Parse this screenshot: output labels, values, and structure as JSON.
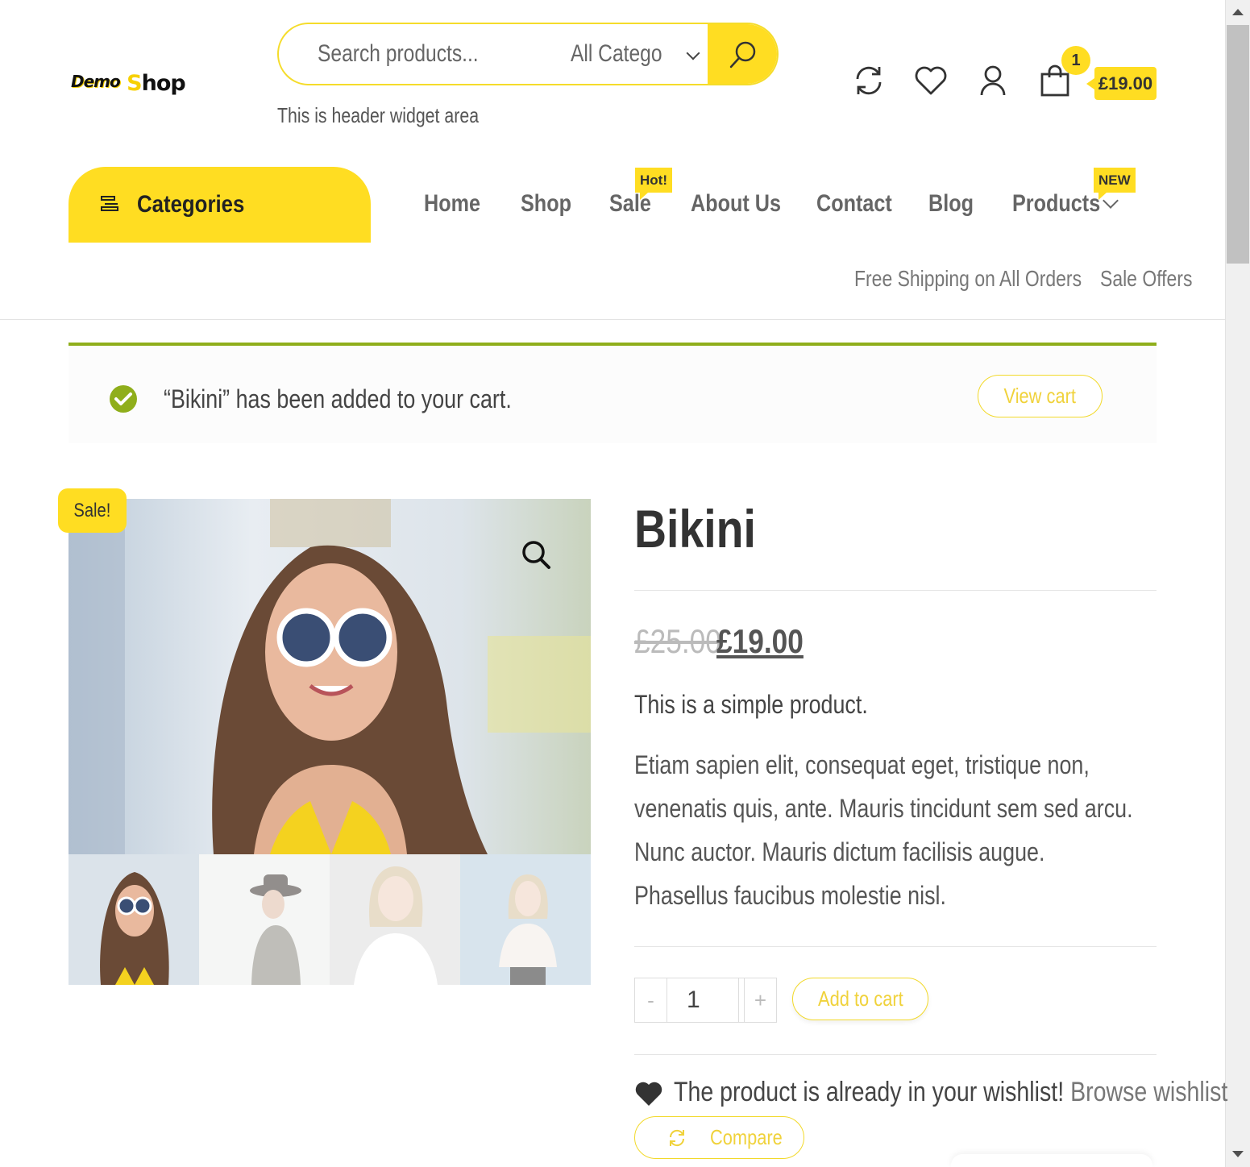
{
  "header": {
    "logo_demo": "Demo",
    "logo_s": "S",
    "logo_hop": "hop",
    "search_placeholder": "Search products...",
    "search_category": "All Categories",
    "widget_note": "This is header widget area",
    "cart_count": "1",
    "cart_total": "£19.00"
  },
  "nav": {
    "categories_label": "Categories",
    "items": [
      {
        "label": "Home"
      },
      {
        "label": "Shop"
      },
      {
        "label": "Sale",
        "badge": "Hot!"
      },
      {
        "label": "About Us"
      },
      {
        "label": "Contact"
      },
      {
        "label": "Blog"
      },
      {
        "label": "Products",
        "badge": "NEW"
      }
    ],
    "subnav": [
      "Free Shipping on All Orders",
      "Sale Offers"
    ]
  },
  "notice": {
    "message": "“Bikini” has been added to your cart.",
    "button": "View cart"
  },
  "product": {
    "sale_badge": "Sale!",
    "title": "Bikini",
    "price_old": "£25.00",
    "price_new": "£19.00",
    "short_description": "This is a simple product.",
    "description": "Etiam sapien elit, consequat eget, tristique non, venenatis quis, ante. Mauris tincidunt sem sed arcu. Nunc auctor. Mauris dictum facilisis augue. Phasellus faucibus molestie nisl.",
    "quantity": "1",
    "qty_minus": "-",
    "qty_plus": "+",
    "add_to_cart": "Add to cart",
    "wishlist_text": "The product is already in your wishlist!",
    "wishlist_link": "Browse wishlist",
    "compare": "Compare"
  },
  "colors": {
    "accent": "#ffdd22",
    "notice_border": "#8fae1b",
    "text": "#444444"
  }
}
